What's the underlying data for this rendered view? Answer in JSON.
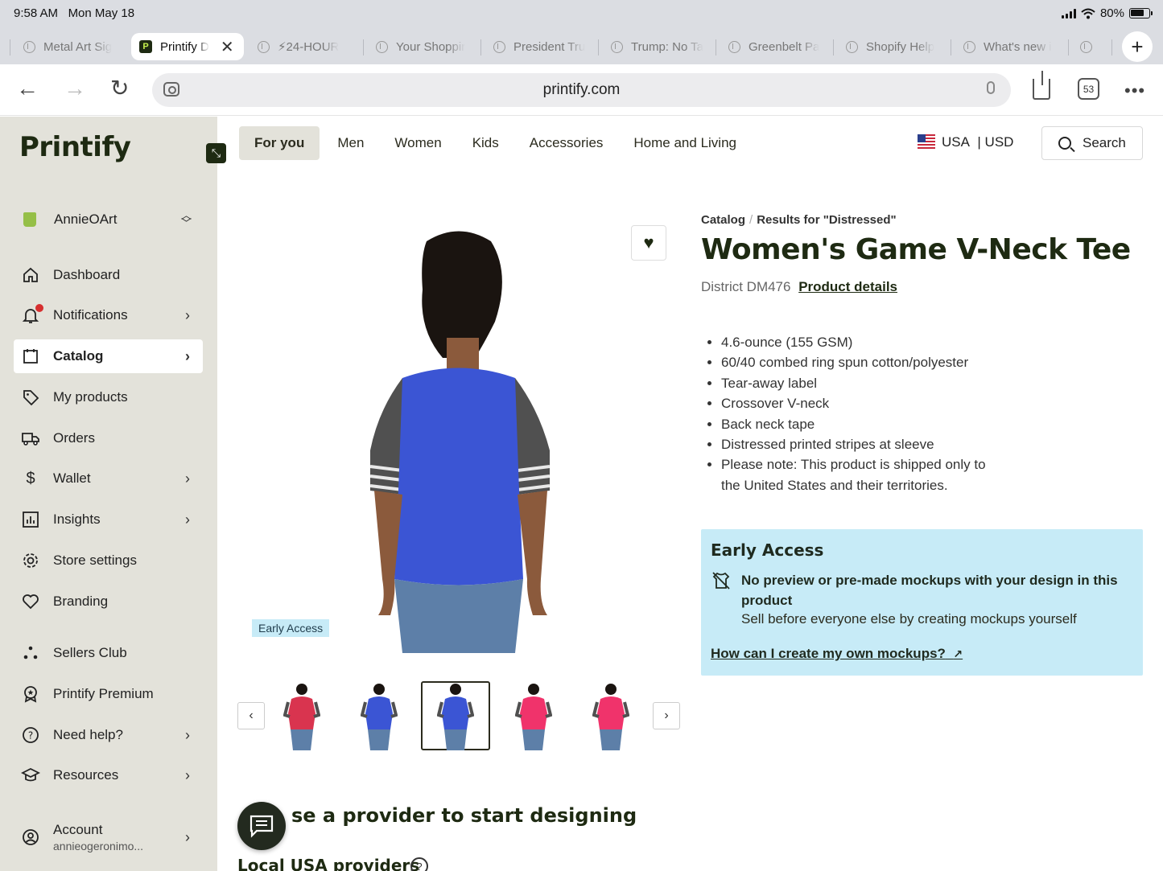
{
  "status": {
    "time": "9:58 AM",
    "date": "Mon May 18",
    "battery": "80%"
  },
  "browser": {
    "tabs": [
      {
        "title": "Metal Art Sig"
      },
      {
        "title": "Printify D"
      },
      {
        "title": "⚡24-HOUR"
      },
      {
        "title": "Your Shoppir"
      },
      {
        "title": "President Tru"
      },
      {
        "title": "Trump: No Ta"
      },
      {
        "title": "Greenbelt Pa"
      },
      {
        "title": "Shopify Help"
      },
      {
        "title": "What's new i"
      }
    ],
    "url": "printify.com",
    "tab_count": "53"
  },
  "sidebar": {
    "logo": "Printify",
    "store": "AnnieOArt",
    "items": [
      {
        "label": "Dashboard",
        "icon": "home-icon"
      },
      {
        "label": "Notifications",
        "icon": "bell-icon"
      },
      {
        "label": "Catalog",
        "icon": "catalog-icon"
      },
      {
        "label": "My products",
        "icon": "tag-icon"
      },
      {
        "label": "Orders",
        "icon": "truck-icon"
      },
      {
        "label": "Wallet",
        "icon": "dollar-icon"
      },
      {
        "label": "Insights",
        "icon": "chart-icon"
      },
      {
        "label": "Store settings",
        "icon": "gear-icon"
      },
      {
        "label": "Branding",
        "icon": "heart-icon"
      },
      {
        "label": "Sellers Club",
        "icon": "dots-icon"
      },
      {
        "label": "Printify Premium",
        "icon": "badge-icon"
      },
      {
        "label": "Need help?",
        "icon": "help-icon"
      },
      {
        "label": "Resources",
        "icon": "graduation-icon"
      },
      {
        "label": "Account",
        "icon": "user-icon",
        "sub": "annieogeronimo..."
      }
    ]
  },
  "catnav": {
    "items": [
      "For you",
      "Men",
      "Women",
      "Kids",
      "Accessories",
      "Home and Living"
    ],
    "region": "USA",
    "currency": "| USD",
    "search": "Search"
  },
  "product": {
    "breadcrumb": [
      "Catalog",
      "Results for \"Distressed\""
    ],
    "title": "Women's Game V-Neck Tee",
    "brand": "District DM476",
    "details_link": "Product details",
    "early_access_tag": "Early Access",
    "bullets": [
      "4.6-ounce (155 GSM)",
      "60/40 combed ring spun cotton/polyester",
      "Tear-away label",
      "Crossover V-neck",
      "Back neck tape",
      "Distressed printed stripes at sleeve",
      "Please note: This product is shipped only to the United States and their territories."
    ],
    "thumb_colors": [
      "#d9344f",
      "#3b55d4",
      "#3b55d4",
      "#f0336b",
      "#f0336b"
    ],
    "main_color": "#3b55d4",
    "sleeve_color": "#505050"
  },
  "early_access": {
    "heading": "Early Access",
    "message": "No preview or pre-made mockups with your design in this product",
    "sub": "Sell before everyone else by creating mockups yourself",
    "link": "How can I create my own mockups?"
  },
  "bottom": {
    "choose": "se a provider to start designing",
    "local": "Local USA providers"
  }
}
